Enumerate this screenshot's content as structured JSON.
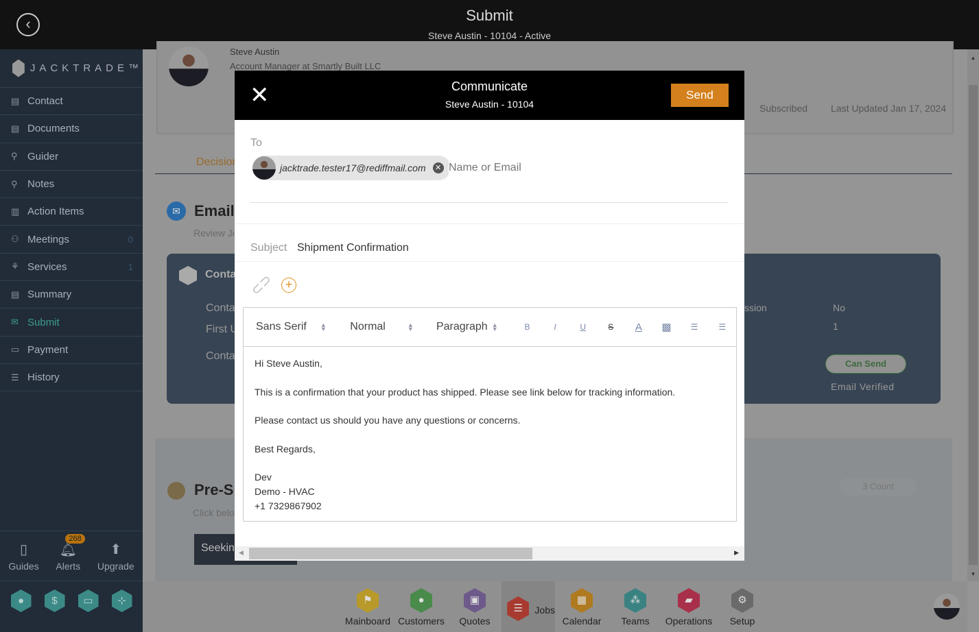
{
  "header": {
    "title": "Submit",
    "subtitle": "Steve Austin - 10104 - Active"
  },
  "sidebar": {
    "brand": "JACKTRADE™",
    "items": [
      {
        "label": "Contact",
        "icon": "contact-book-icon",
        "count": ""
      },
      {
        "label": "Documents",
        "icon": "documents-icon",
        "count": ""
      },
      {
        "label": "Guider",
        "icon": "signpost-icon",
        "count": ""
      },
      {
        "label": "Notes",
        "icon": "signpost-icon",
        "count": ""
      },
      {
        "label": "Action Items",
        "icon": "clipboard-icon",
        "count": ""
      },
      {
        "label": "Meetings",
        "icon": "meetings-icon",
        "count": "0"
      },
      {
        "label": "Services",
        "icon": "services-icon",
        "count": "1"
      },
      {
        "label": "Summary",
        "icon": "summary-icon",
        "count": ""
      },
      {
        "label": "Submit",
        "icon": "submit-mail-icon",
        "count": "",
        "active": true
      },
      {
        "label": "Payment",
        "icon": "payment-icon",
        "count": ""
      },
      {
        "label": "History",
        "icon": "history-icon",
        "count": ""
      }
    ],
    "bottom": {
      "guides": "Guides",
      "alerts": "Alerts",
      "alerts_count": "268",
      "upgrade": "Upgrade"
    }
  },
  "background": {
    "name": "Steve Austin",
    "role": "Account Manager at Smartly Built LLC",
    "subscribed": "Subscribed",
    "last_updated": "Last Updated Jan 17, 2024",
    "tab": "Decision",
    "email_title": "Email",
    "email_sub": "Review Jo",
    "card_title": "Conta",
    "card_rows": [
      "Conta",
      "First U",
      "Conta"
    ],
    "permission_label": "ssion",
    "permission_value": "No",
    "count_value": "1",
    "can_send": "Can Send",
    "email_verified": "Email Verified",
    "pre_title": "Pre-S",
    "pre_sub": "Click belo",
    "seeking": "Seekin",
    "count_badge": "3 Count"
  },
  "bottom_nav": [
    {
      "label": "Mainboard",
      "color": "#b89a2a"
    },
    {
      "label": "Customers",
      "color": "#4a8a4a"
    },
    {
      "label": "Quotes",
      "color": "#6e5a8a"
    },
    {
      "label": "Jobs",
      "color": "#a83a30",
      "selected": true
    },
    {
      "label": "Calendar",
      "color": "#b07a20"
    },
    {
      "label": "Teams",
      "color": "#3a8282"
    },
    {
      "label": "Operations",
      "color": "#a8304a"
    },
    {
      "label": "Setup",
      "color": "#6a6a6a"
    }
  ],
  "modal": {
    "title": "Communicate",
    "subtitle": "Steve Austin - 10104",
    "send": "Send",
    "to_label": "To",
    "recipient": "jacktrade.tester17@rediffmail.com",
    "to_placeholder": "Name or Email",
    "subject_label": "Subject",
    "subject": "Shipment Confirmation",
    "toolbar": {
      "font": "Sans Serif",
      "size": "Normal",
      "format": "Paragraph"
    },
    "body": [
      "Hi Steve Austin,",
      "This is a confirmation that your product has shipped. Please see link below for tracking information.",
      "Please contact us should you have any questions or concerns.",
      "Best Regards,"
    ],
    "signature": [
      "Dev",
      "Demo - HVAC",
      "+1 7329867902"
    ]
  },
  "colors": {
    "accent": "#d4801c",
    "active_nav": "#3c9a8e"
  }
}
